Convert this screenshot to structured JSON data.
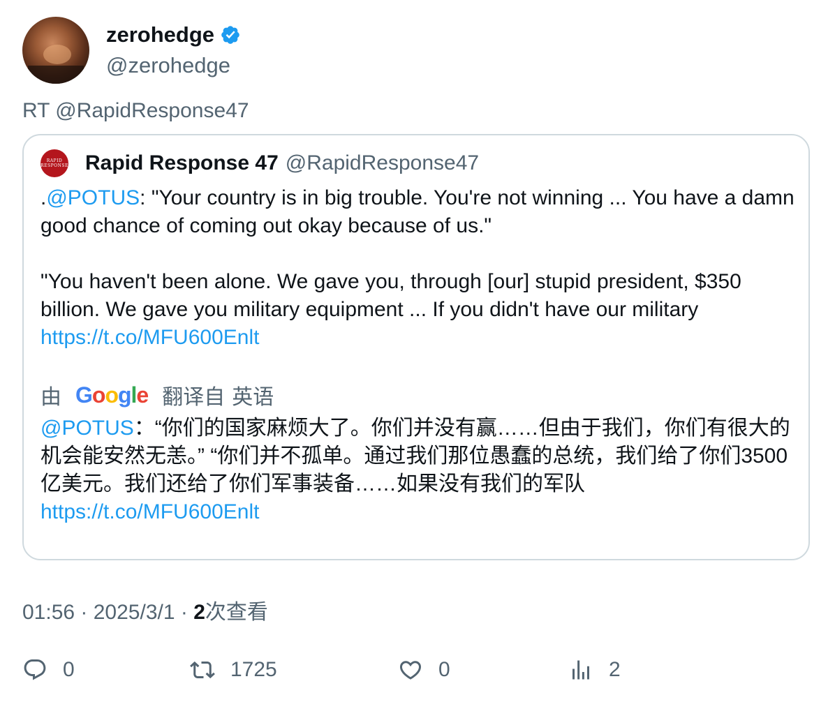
{
  "author": {
    "name": "zerohedge",
    "handle": "@zerohedge"
  },
  "retweet_line": "RT @RapidResponse47",
  "quoted": {
    "name": "Rapid Response 47",
    "handle": "@RapidResponse47",
    "avatar_text": "RAPID RESPONSE",
    "body": {
      "p1_prefix": ".",
      "p1_mention": "@POTUS",
      "p1_text": ": \"Your country is in big trouble. You're not winning ... You have a damn good chance of coming out okay because of us.\"",
      "p2_text": "\"You haven't been alone. We gave you, through [our] stupid president, $350 billion. We gave you military equipment ... If you didn't have our military",
      "p2_link": "https://t.co/MFU600Enlt"
    },
    "translation": {
      "by": "由",
      "logo": {
        "G": "G",
        "o1": "o",
        "o2": "o",
        "g": "g",
        "l": "l",
        "e": "e"
      },
      "from_label": "翻译自",
      "language": "英语",
      "mention": "@POTUS",
      "text": "：“你们的国家麻烦大了。你们并没有赢……但由于我们，你们有很大的机会能安然无恙。” “你们并不孤单。通过我们那位愚蠢的总统，我们给了你们3500亿美元。我们还给了你们军事装备……如果没有我们的军队",
      "link": "https://t.co/MFU600Enlt"
    }
  },
  "meta": {
    "time": "01:56",
    "date": "2025/3/1",
    "views_count": "2",
    "views_label": "次查看",
    "separator": " · "
  },
  "actions": {
    "replies": "0",
    "retweets": "1725",
    "likes": "0",
    "views": "2"
  },
  "colors": {
    "link": "#1d9bf0",
    "verified": "#1d9bf0",
    "secondary_text": "#536471",
    "border": "#cfd9de"
  }
}
